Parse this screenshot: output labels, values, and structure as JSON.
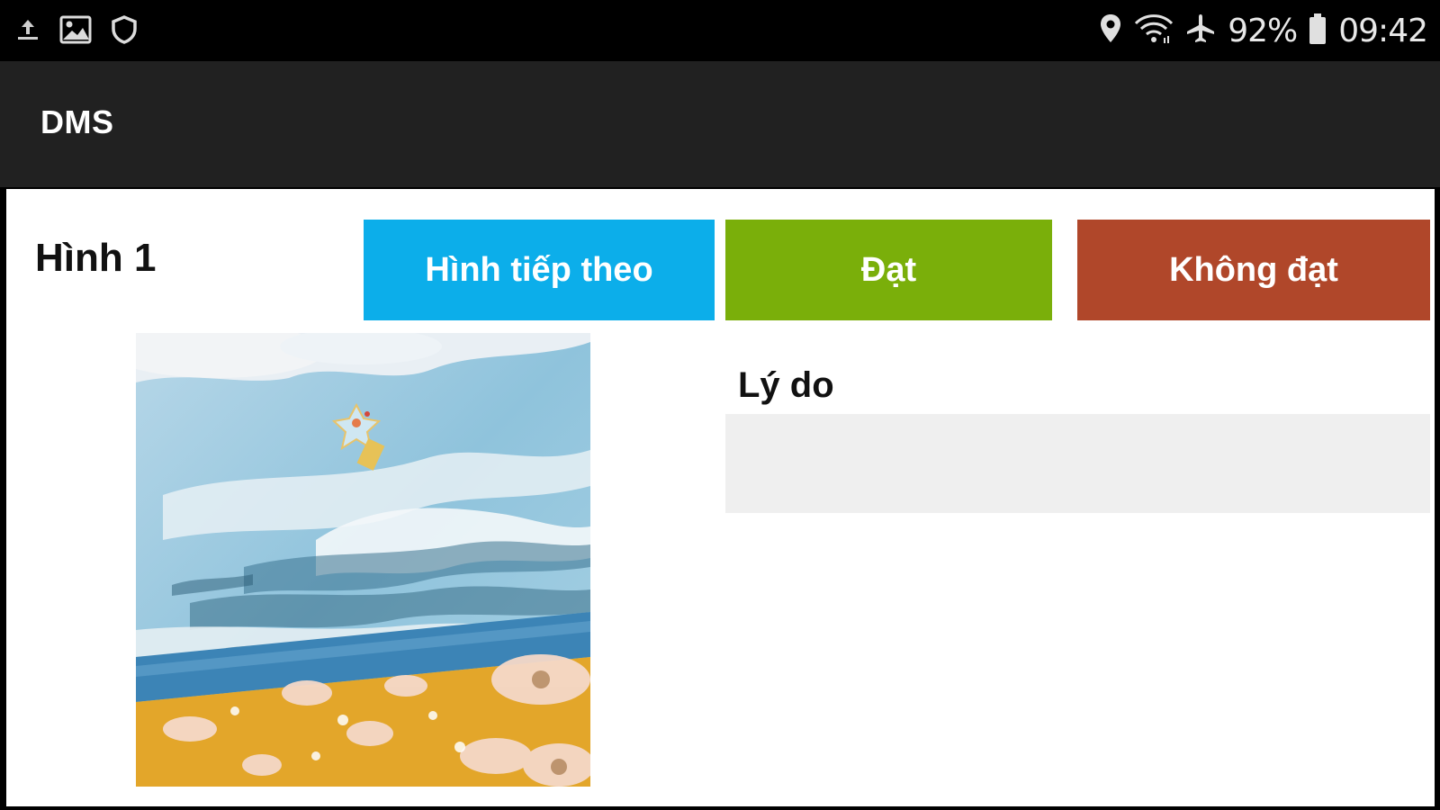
{
  "status_bar": {
    "battery_percent": "92%",
    "time": "09:42",
    "left_icons": [
      "upload-icon",
      "image-icon",
      "shield-icon"
    ],
    "right_icons": [
      "location-icon",
      "wifi-icon",
      "airplane-icon",
      "battery-icon"
    ]
  },
  "action_bar": {
    "title": "DMS"
  },
  "main": {
    "image_label": "Hình 1",
    "buttons": {
      "next_image": "Hình tiếp theo",
      "pass": "Đạt",
      "fail": "Không đạt"
    },
    "reason": {
      "label": "Lý do",
      "value": "",
      "placeholder": ""
    }
  },
  "colors": {
    "next_button": "#0caeea",
    "pass_button": "#7aaf0a",
    "fail_button": "#b0472a",
    "action_bar": "#212121"
  }
}
